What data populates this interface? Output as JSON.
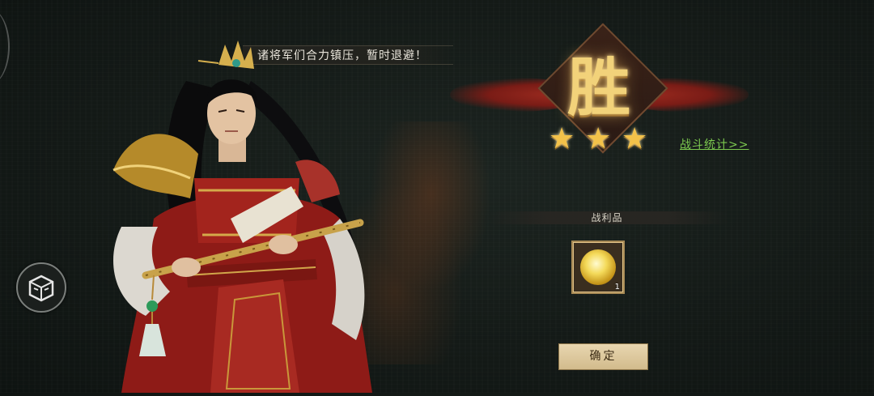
{
  "dialog": {
    "text": "诸将军们合力镇压，暂时退避！"
  },
  "result": {
    "victory_text": "胜",
    "stars": 3,
    "star_glyph": "★",
    "battle_stats_link": "战斗统计>>"
  },
  "loot": {
    "title": "战利品",
    "items": [
      {
        "icon": "golden-orb-icon",
        "count": "1"
      }
    ]
  },
  "actions": {
    "confirm_label": "确定"
  },
  "side": {
    "badge_icon": "crate-icon"
  },
  "colors": {
    "link_green": "#7cc94f",
    "gold": "#f2d27a",
    "ribbon_red": "#9b2a1f"
  }
}
